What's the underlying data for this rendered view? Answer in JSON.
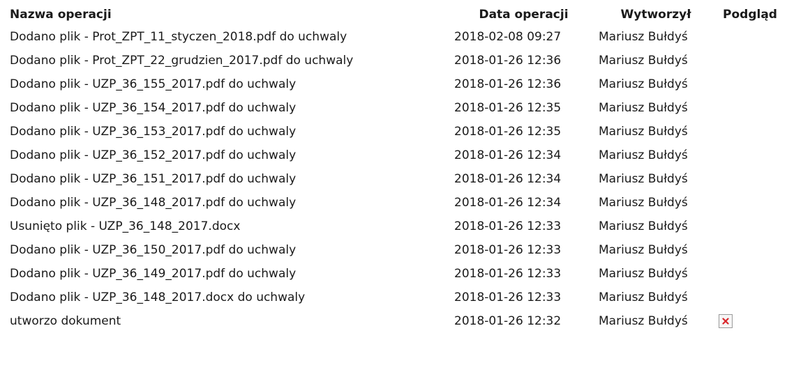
{
  "table": {
    "headers": {
      "name": "Nazwa operacji",
      "date": "Data operacji",
      "author": "Wytworzył",
      "preview": "Podgląd"
    },
    "rows": [
      {
        "name": "Dodano plik - Prot_ZPT_11_styczen_2018.pdf do uchwaly",
        "date": "2018-02-08 09:27",
        "author": "Mariusz Bułdyś"
      },
      {
        "name": "Dodano plik - Prot_ZPT_22_grudzien_2017.pdf do uchwaly",
        "date": "2018-01-26 12:36",
        "author": "Mariusz Bułdyś"
      },
      {
        "name": "Dodano plik - UZP_36_155_2017.pdf do uchwaly",
        "date": "2018-01-26 12:36",
        "author": "Mariusz Bułdyś"
      },
      {
        "name": "Dodano plik - UZP_36_154_2017.pdf do uchwaly",
        "date": "2018-01-26 12:35",
        "author": "Mariusz Bułdyś"
      },
      {
        "name": "Dodano plik - UZP_36_153_2017.pdf do uchwaly",
        "date": "2018-01-26 12:35",
        "author": "Mariusz Bułdyś"
      },
      {
        "name": "Dodano plik - UZP_36_152_2017.pdf do uchwaly",
        "date": "2018-01-26 12:34",
        "author": "Mariusz Bułdyś"
      },
      {
        "name": "Dodano plik - UZP_36_151_2017.pdf do uchwaly",
        "date": "2018-01-26 12:34",
        "author": "Mariusz Bułdyś"
      },
      {
        "name": "Dodano plik - UZP_36_148_2017.pdf do uchwaly",
        "date": "2018-01-26 12:34",
        "author": "Mariusz Bułdyś"
      },
      {
        "name": "Usunięto plik - UZP_36_148_2017.docx",
        "date": "2018-01-26 12:33",
        "author": "Mariusz Bułdyś"
      },
      {
        "name": "Dodano plik - UZP_36_150_2017.pdf do uchwaly",
        "date": "2018-01-26 12:33",
        "author": "Mariusz Bułdyś"
      },
      {
        "name": "Dodano plik - UZP_36_149_2017.pdf do uchwaly",
        "date": "2018-01-26 12:33",
        "author": "Mariusz Bułdyś"
      },
      {
        "name": "Dodano plik - UZP_36_148_2017.docx do uchwaly",
        "date": "2018-01-26 12:33",
        "author": "Mariusz Bułdyś"
      },
      {
        "name": "utworzo dokument",
        "date": "2018-01-26 12:32",
        "author": "Mariusz Bułdyś",
        "preview_icon": "broken-image-icon"
      }
    ]
  },
  "colors": {
    "text": "#1a1a1a",
    "preview_icon_x": "#d9262b"
  }
}
